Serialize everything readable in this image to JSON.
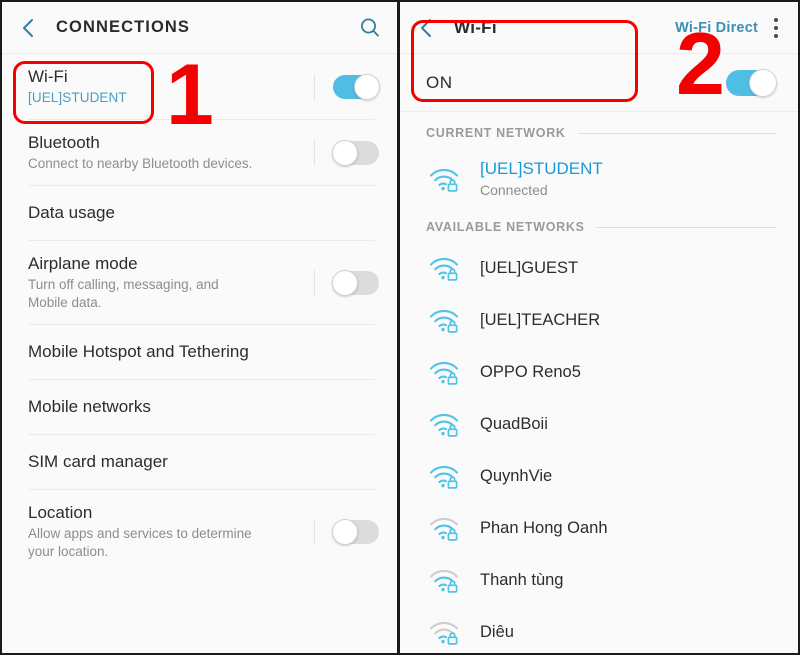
{
  "left_panel": {
    "appbar": {
      "back_icon": "back-arrow-icon",
      "title": "CONNECTIONS",
      "search_icon": "search-icon"
    },
    "items": [
      {
        "title": "Wi-Fi",
        "subtitle": "[UEL]STUDENT",
        "subtitle_accent": true,
        "toggle": "on"
      },
      {
        "title": "Bluetooth",
        "subtitle": "Connect to nearby Bluetooth devices.",
        "subtitle_accent": false,
        "toggle": "off"
      },
      {
        "title": "Data usage",
        "subtitle": "",
        "subtitle_accent": false,
        "toggle": "none"
      },
      {
        "title": "Airplane mode",
        "subtitle": "Turn off calling, messaging, and Mobile data.",
        "subtitle_accent": false,
        "toggle": "off"
      },
      {
        "title": "Mobile Hotspot and Tethering",
        "subtitle": "",
        "subtitle_accent": false,
        "toggle": "none"
      },
      {
        "title": "Mobile networks",
        "subtitle": "",
        "subtitle_accent": false,
        "toggle": "none"
      },
      {
        "title": "SIM card manager",
        "subtitle": "",
        "subtitle_accent": false,
        "toggle": "none"
      },
      {
        "title": "Location",
        "subtitle": "Allow apps and services to determine your location.",
        "subtitle_accent": false,
        "toggle": "off"
      }
    ]
  },
  "right_panel": {
    "appbar": {
      "back_icon": "back-arrow-icon",
      "title": "Wi-Fi",
      "action_label": "Wi-Fi Direct",
      "overflow_icon": "more-options-icon"
    },
    "power": {
      "label": "ON",
      "toggle": "on"
    },
    "sections": [
      {
        "header": "CURRENT NETWORK",
        "networks": [
          {
            "name": "[UEL]STUDENT",
            "status": "Connected",
            "connected": true,
            "secured": true,
            "signal": "strong"
          }
        ]
      },
      {
        "header": "AVAILABLE NETWORKS",
        "networks": [
          {
            "name": "[UEL]GUEST",
            "status": "",
            "connected": false,
            "secured": true,
            "signal": "strong"
          },
          {
            "name": "[UEL]TEACHER",
            "status": "",
            "connected": false,
            "secured": true,
            "signal": "strong"
          },
          {
            "name": "OPPO Reno5",
            "status": "",
            "connected": false,
            "secured": true,
            "signal": "strong"
          },
          {
            "name": "QuadBoii",
            "status": "",
            "connected": false,
            "secured": true,
            "signal": "strong"
          },
          {
            "name": "QuynhVie",
            "status": "",
            "connected": false,
            "secured": true,
            "signal": "strong"
          },
          {
            "name": "Phan Hong Oanh",
            "status": "",
            "connected": false,
            "secured": true,
            "signal": "medium"
          },
          {
            "name": "Thanh tùng",
            "status": "",
            "connected": false,
            "secured": true,
            "signal": "medium"
          },
          {
            "name": "Diêu",
            "status": "",
            "connected": false,
            "secured": true,
            "signal": "weak"
          }
        ]
      }
    ]
  },
  "annotations": [
    {
      "label": "1",
      "target": "wifi-settings-row"
    },
    {
      "label": "2",
      "target": "current-network-row"
    }
  ],
  "colors": {
    "accent_blue": "#1a9bd7",
    "toggle_on": "#4fbde4",
    "link_teal": "#3d8fb5",
    "annotation_red": "#f40000",
    "icon_blue": "#4fc3e8",
    "icon_gray": "#c8c8c8",
    "text_primary": "#2c2c2c",
    "text_secondary": "#8d8d8d",
    "background": "#fafafa"
  }
}
